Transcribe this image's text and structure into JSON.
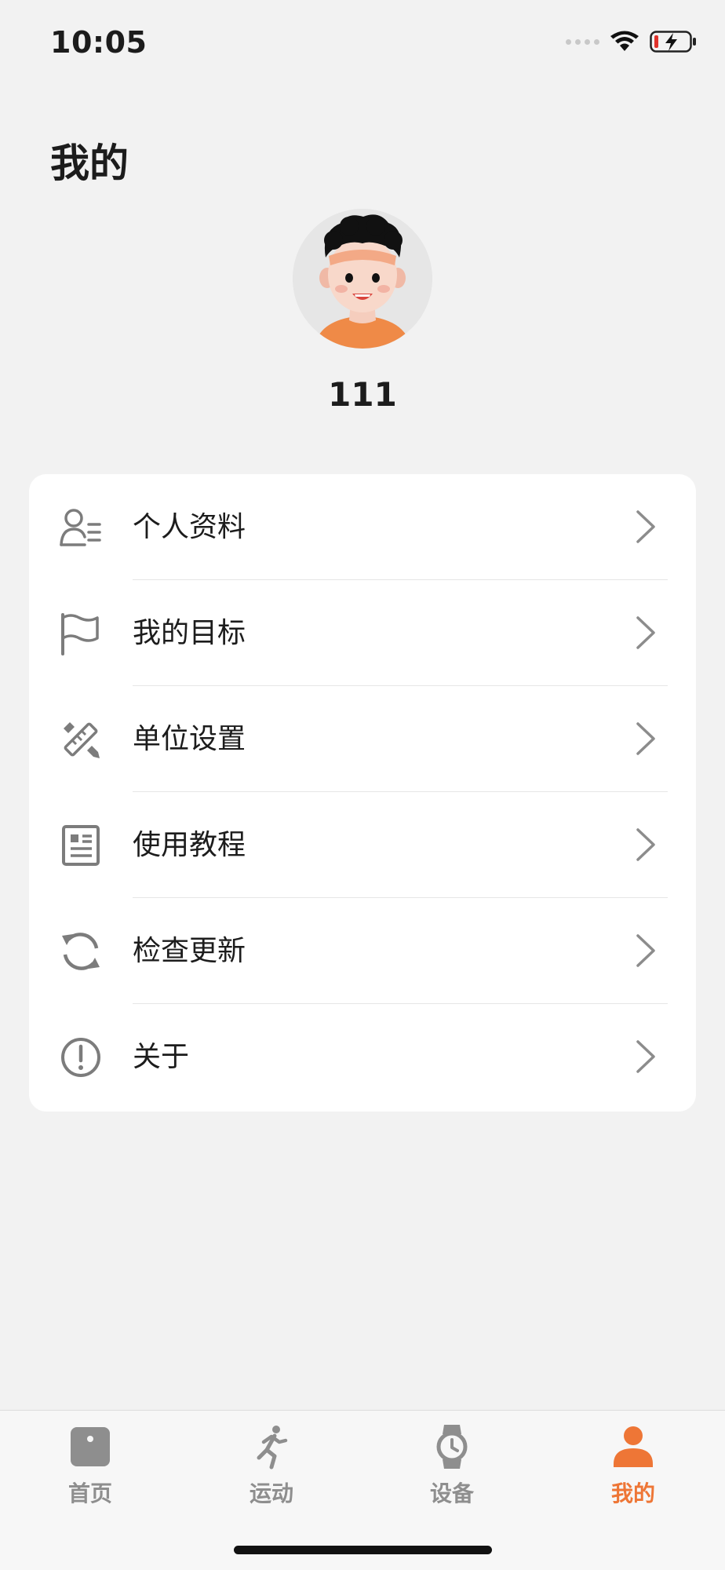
{
  "status_bar": {
    "time": "10:05",
    "icons": [
      "signal-icon",
      "wifi-icon",
      "battery-charging-icon"
    ],
    "battery_color": "#e0322b"
  },
  "header": {
    "title": "我的"
  },
  "profile": {
    "username": "111",
    "avatar_icon": "cartoon-avatar"
  },
  "menu": {
    "items": [
      {
        "label": "个人资料",
        "icon": "user-list-icon"
      },
      {
        "label": "我的目标",
        "icon": "flag-icon"
      },
      {
        "label": "单位设置",
        "icon": "ruler-pencil-icon"
      },
      {
        "label": "使用教程",
        "icon": "document-icon"
      },
      {
        "label": "检查更新",
        "icon": "refresh-icon"
      },
      {
        "label": "关于",
        "icon": "info-exclamation-icon"
      }
    ]
  },
  "tab_bar": {
    "tabs": [
      {
        "label": "首页",
        "icon": "home-icon"
      },
      {
        "label": "运动",
        "icon": "running-icon"
      },
      {
        "label": "设备",
        "icon": "watch-icon"
      },
      {
        "label": "我的",
        "icon": "profile-icon"
      }
    ],
    "active_index": 3,
    "active_color": "#ee7636",
    "inactive_color": "#8e8e8e"
  }
}
